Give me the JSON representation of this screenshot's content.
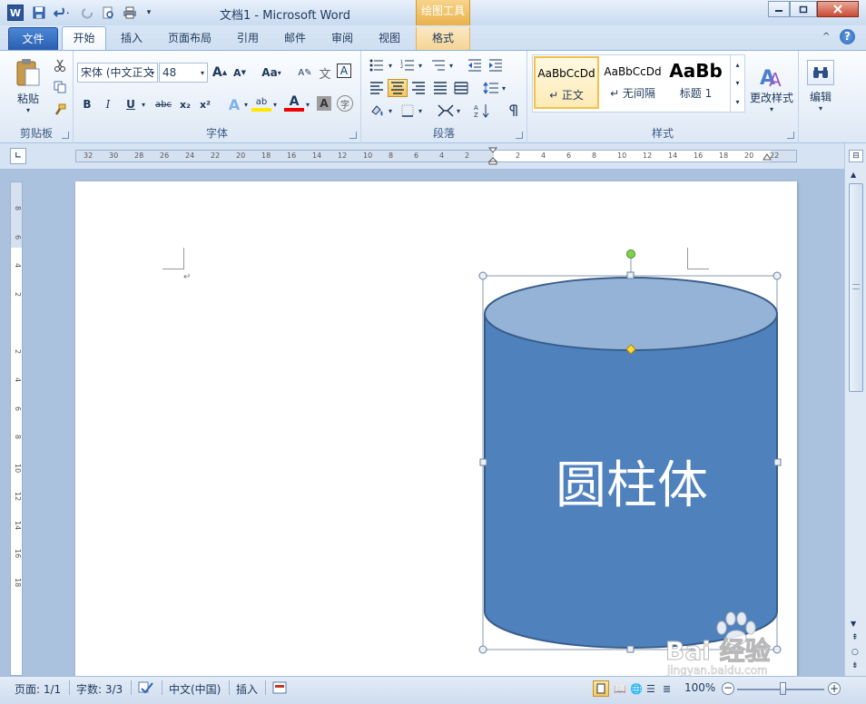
{
  "title": {
    "doc": "文档1",
    "app": "Microsoft Word",
    "separator": " - "
  },
  "contextual_tab": {
    "group_label": "绘图工具",
    "tab_label": "格式"
  },
  "tabs": [
    {
      "label": "文件"
    },
    {
      "label": "开始"
    },
    {
      "label": "插入"
    },
    {
      "label": "页面布局"
    },
    {
      "label": "引用"
    },
    {
      "label": "邮件"
    },
    {
      "label": "审阅"
    },
    {
      "label": "视图"
    }
  ],
  "ribbon": {
    "clipboard": {
      "paste_label": "粘贴",
      "group_label": "剪贴板"
    },
    "font": {
      "font_name": "宋体 (中文正文",
      "font_size": "48",
      "change_case": "Aa",
      "bold": "B",
      "italic": "I",
      "underline": "U",
      "strike": "abc",
      "sub": "x₂",
      "sup": "x²",
      "phonetic": "字",
      "border_char": "A",
      "grow": "A",
      "shrink": "A",
      "highlight_text": "ab",
      "color_text": "A",
      "shade_text": "A",
      "group_label": "字体"
    },
    "paragraph": {
      "group_label": "段落"
    },
    "styles": {
      "items": [
        {
          "sample": "AaBbCcDd",
          "name": "↵ 正文"
        },
        {
          "sample": "AaBbCcDd",
          "name": "↵ 无间隔"
        },
        {
          "sample": "AaBb",
          "name": "标题 1"
        }
      ],
      "change_label": "更改样式",
      "group_label": "样式"
    },
    "editing": {
      "label": "编辑"
    }
  },
  "rulers": {
    "h_ticks": [
      "32",
      "30",
      "28",
      "26",
      "24",
      "22",
      "20",
      "18",
      "16",
      "14",
      "12",
      "10",
      "8",
      "6",
      "4",
      "2",
      "",
      "2",
      "4",
      "6",
      "8",
      "10",
      "12",
      "14",
      "16",
      "18",
      "20",
      "22"
    ],
    "v_ticks": [
      "8",
      "6",
      "4",
      "2",
      "",
      "2",
      "4",
      "6",
      "8",
      "10",
      "12",
      "14",
      "16",
      "18"
    ]
  },
  "document": {
    "paragraph_mark": "↵",
    "shape_text": "圆柱体",
    "shape_fill": "#4f81bd",
    "shape_top_fill": "#95b3d7",
    "shape_stroke": "#385d8a"
  },
  "status": {
    "page": "页面: 1/1",
    "words": "字数: 3/3",
    "language": "中文(中国)",
    "mode": "插入",
    "zoom": "100%"
  },
  "watermark": {
    "brand": "Bai 经验",
    "url": "jingyan.baidu.com"
  }
}
